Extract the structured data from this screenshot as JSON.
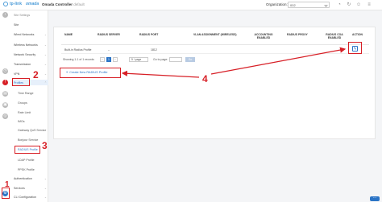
{
  "topbar": {
    "brand": "tp-link",
    "product": "omada",
    "title": "Omada Controller",
    "title_suffix": "default",
    "org_label": "Organization:",
    "org_value": "002"
  },
  "sidebar": {
    "settings_heading": "Site Settings",
    "items": [
      {
        "label": "Site"
      },
      {
        "label": "Wired Networks"
      },
      {
        "label": "Wireless Networks"
      },
      {
        "label": "Network Security"
      },
      {
        "label": "Transmission"
      },
      {
        "label": "VPN"
      },
      {
        "label": "Profiles"
      },
      {
        "label": "Time Range"
      },
      {
        "label": "Groups"
      },
      {
        "label": "Rate Limit"
      },
      {
        "label": "IMGs"
      },
      {
        "label": "Gateway QoS Service"
      },
      {
        "label": "Bonjour Service"
      },
      {
        "label": "RADIUS Profile"
      },
      {
        "label": "LDAP Profile"
      },
      {
        "label": "PPSK Profile"
      },
      {
        "label": "Authentication"
      },
      {
        "label": "Services"
      },
      {
        "label": "CLI Configuration"
      }
    ]
  },
  "annotations": {
    "step1": "1",
    "step2": "2",
    "step3": "3",
    "step4": "4"
  },
  "table": {
    "headers": [
      "NAME",
      "RADIUS SERVER",
      "RADIUS PORT",
      "VLAN ASSIGNMENT (WIRELESS)",
      "ACCOUNTING ENABLED",
      "RADIUS PROXY",
      "RADIUS COA ENABLED",
      "ACTION"
    ],
    "rows": [
      {
        "name": "Built-in Radius Profile",
        "server": "--",
        "port": "1812",
        "vlan": "",
        "accounting": "",
        "proxy": "",
        "coa": ""
      }
    ]
  },
  "pager": {
    "summary": "Showing 1-1 of 1 records",
    "prev": "‹",
    "current": "1",
    "next": "›",
    "page_size": "5 / page",
    "goto_label": "Go to page:",
    "go": "Go"
  },
  "actions": {
    "create_label": "Create New RADIUS Profile"
  },
  "colors": {
    "accent": "#2b74c6",
    "annotation": "#d71f26"
  }
}
